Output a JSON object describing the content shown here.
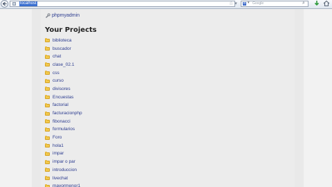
{
  "browser": {
    "url_text": "localhost",
    "search_placeholder": "Google",
    "search_engine_letter": "8"
  },
  "page": {
    "tool_link": "phpmyadmin",
    "section_title": "Your Projects",
    "projects": [
      {
        "label": "biblioteca"
      },
      {
        "label": "buscador"
      },
      {
        "label": "chat"
      },
      {
        "label": "clase_02.1"
      },
      {
        "label": "css"
      },
      {
        "label": "curso"
      },
      {
        "label": "divisores"
      },
      {
        "label": "Encuestas"
      },
      {
        "label": "factorial"
      },
      {
        "label": "facturacionphp"
      },
      {
        "label": "fibonacci"
      },
      {
        "label": "formularios"
      },
      {
        "label": "Foro"
      },
      {
        "label": "hola1"
      },
      {
        "label": "impar"
      },
      {
        "label": "impar o par"
      },
      {
        "label": "introduccion"
      },
      {
        "label": "livechat"
      },
      {
        "label": "mayormenor1"
      }
    ]
  },
  "colors": {
    "link": "#2b3b8f",
    "page_background": "#ececec",
    "folder": "#f2c94c"
  }
}
